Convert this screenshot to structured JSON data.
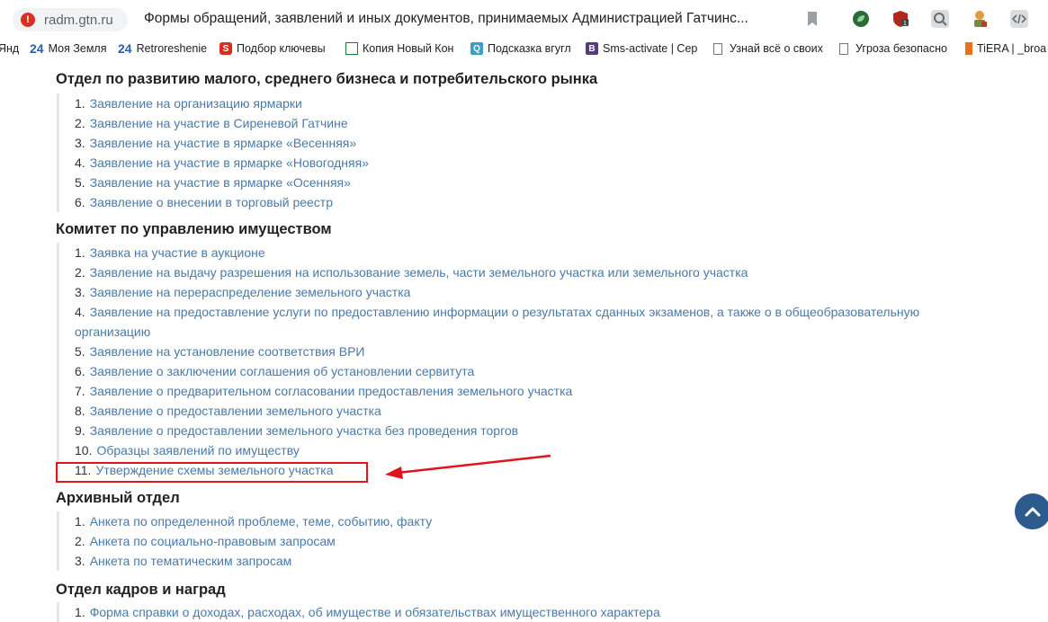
{
  "browser": {
    "site_host": "radm.gtn.ru",
    "page_title": "Формы обращений, заявлений и иных документов, принимаемых Администрацией Гатчинс...",
    "bookmarks": [
      {
        "icon": "yandex-icon",
        "label": "Янд"
      },
      {
        "icon": "24-icon",
        "label": "Моя Земля"
      },
      {
        "icon": "24-icon",
        "label": "Retroreshenie"
      },
      {
        "icon": "s-icon",
        "label": "Подбор ключевы"
      },
      {
        "icon": "sheet-icon",
        "label": "Копия Новый Кон"
      },
      {
        "icon": "search-icon",
        "label": "Подсказка вгугл"
      },
      {
        "icon": "b-icon",
        "label": "Sms-activate | Сер"
      },
      {
        "icon": "page-icon",
        "label": "Узнай всё о своих"
      },
      {
        "icon": "page-icon",
        "label": "Угроза безопасно"
      },
      {
        "icon": "tiera-icon",
        "label": "TiERA | _broa"
      }
    ],
    "accent_colors": {
      "warning": "#d93025",
      "link": "#4a7aa8",
      "highlight": "#e0141c",
      "scroll_button": "#2d5b8e"
    }
  },
  "sections": [
    {
      "title": "Отдел по развитию малого, среднего бизнеса и потребительского рынка",
      "items": [
        {
          "num": "1.",
          "text": "Заявление на организацию ярмарки"
        },
        {
          "num": "2.",
          "text": "Заявление на участие в Сиреневой Гатчине"
        },
        {
          "num": "3.",
          "text": "Заявление на участие в ярмарке «Весенняя»"
        },
        {
          "num": "4.",
          "text": "Заявление на участие в ярмарке «Новогодняя»"
        },
        {
          "num": "5.",
          "text": "Заявление на участие в ярмарке «Осенняя»"
        },
        {
          "num": "6.",
          "text": "Заявление о внесении в торговый реестр"
        }
      ]
    },
    {
      "title": "Комитет по управлению имуществом",
      "items": [
        {
          "num": "1.",
          "text": "Заявка на участие в аукционе"
        },
        {
          "num": "2.",
          "text": "Заявление на выдачу разрешения на использование земель, части земельного участка или земельного участка"
        },
        {
          "num": "3.",
          "text": "Заявление на перераспределение земельного участка"
        },
        {
          "num": "4.",
          "text": "Заявление на предоставление услуги по предоставлению информации о результатах сданных экзаменов, а также о в общеобразовательную организацию"
        },
        {
          "num": "5.",
          "text": "Заявление на установление соответствия ВРИ"
        },
        {
          "num": "6.",
          "text": "Заявление о заключении соглашения об установлении сервитута"
        },
        {
          "num": "7.",
          "text": "Заявление о предварительном согласовании предоставления земельного участка"
        },
        {
          "num": "8.",
          "text": "Заявление о предоставлении земельного участка"
        },
        {
          "num": "9.",
          "text": "Заявление о предоставлении земельного участка без проведения торгов"
        },
        {
          "num": "10.",
          "text": "Образцы заявлений по имуществу"
        },
        {
          "num": "11.",
          "text": "Утверждение схемы земельного участка"
        }
      ]
    },
    {
      "title": "Архивный отдел",
      "items": [
        {
          "num": "1.",
          "text": "Анкета по определенной проблеме, теме, событию, факту"
        },
        {
          "num": "2.",
          "text": "Анкета по социально-правовым запросам"
        },
        {
          "num": "3.",
          "text": "Анкета по тематическим запросам"
        }
      ]
    },
    {
      "title": "Отдел кадров и наград",
      "items": [
        {
          "num": "1.",
          "text": "Форма справки о доходах, расходах, об имуществе и обязательствах имущественного характера"
        }
      ]
    }
  ]
}
